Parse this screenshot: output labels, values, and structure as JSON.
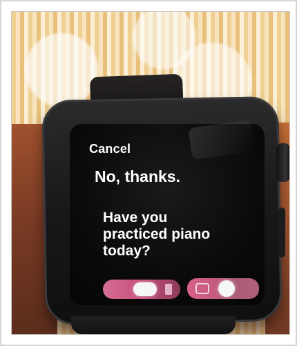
{
  "watch": {
    "cancel_label": "Cancel",
    "quick_reply": "No, thanks.",
    "message_text": "Have you practiced piano today?"
  },
  "colors": {
    "frame_border": "#d9d6d2",
    "screen_background": "#0b0b0c",
    "text": "#ffffff",
    "accent_pink": "#d66f95",
    "band_black": "#171616"
  },
  "icons": {
    "dictation": "microphone-icon",
    "scribble": "pen-icon"
  }
}
